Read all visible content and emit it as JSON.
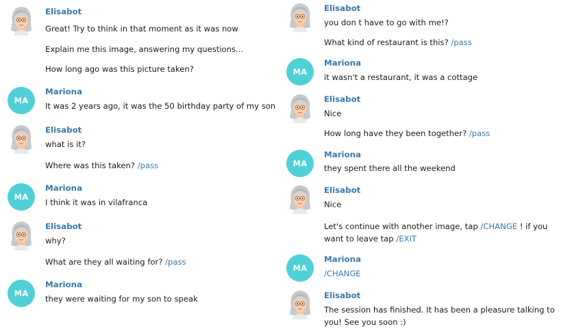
{
  "left": [
    {
      "sender": "Elisabot",
      "type": "bot",
      "lines": [
        {
          "text": "Great! Try to think in that moment as it was now",
          "cmd": ""
        },
        {
          "text": "Explain me this image, answering my questions...",
          "cmd": ""
        },
        {
          "text": "How long ago was this picture taken?",
          "cmd": ""
        }
      ]
    },
    {
      "sender": "Mariona",
      "type": "user",
      "initials": "MA",
      "lines": [
        {
          "text": "It was 2 years ago, it was the 50 birthday party of my son",
          "cmd": ""
        }
      ]
    },
    {
      "sender": "Elisabot",
      "type": "bot",
      "lines": [
        {
          "text": "what is it?",
          "cmd": ""
        },
        {
          "text": "Where was this taken?",
          "cmd": "/pass"
        }
      ]
    },
    {
      "sender": "Mariona",
      "type": "user",
      "initials": "MA",
      "lines": [
        {
          "text": "I think it was in vilafranca",
          "cmd": ""
        }
      ]
    },
    {
      "sender": "Elisabot",
      "type": "bot",
      "lines": [
        {
          "text": "why?",
          "cmd": ""
        },
        {
          "text": "What are they all waiting for?",
          "cmd": "/pass"
        }
      ]
    },
    {
      "sender": "Mariona",
      "type": "user",
      "initials": "MA",
      "lines": [
        {
          "text": "they were waiting for my son to speak",
          "cmd": ""
        }
      ]
    }
  ],
  "right": [
    {
      "sender": "Elisabot",
      "type": "bot",
      "lines": [
        {
          "text": "you don t have to go with me!?",
          "cmd": ""
        },
        {
          "text": "What kind of restaurant is this?",
          "cmd": "/pass"
        }
      ]
    },
    {
      "sender": "Mariona",
      "type": "user",
      "initials": "MA",
      "lines": [
        {
          "text": "it wasn't a restaurant, it was a cottage",
          "cmd": ""
        }
      ]
    },
    {
      "sender": "Elisabot",
      "type": "bot",
      "lines": [
        {
          "text": "Nice",
          "cmd": ""
        },
        {
          "text": "How long have they been together?",
          "cmd": "/pass"
        }
      ]
    },
    {
      "sender": "Mariona",
      "type": "user",
      "initials": "MA",
      "lines": [
        {
          "text": "they spent there all the weekend",
          "cmd": ""
        }
      ]
    },
    {
      "sender": "Elisabot",
      "type": "bot",
      "lines": [
        {
          "text": "Nice",
          "cmd": ""
        },
        {
          "parts": [
            {
              "text": "Let's continue with another image, tap ",
              "cmd": false
            },
            {
              "text": "/CHANGE",
              "cmd": true
            },
            {
              "text": " ! if you want to leave tap ",
              "cmd": false
            },
            {
              "text": "/EXIT",
              "cmd": true
            }
          ]
        }
      ]
    },
    {
      "sender": "Mariona",
      "type": "user",
      "initials": "MA",
      "lines": [
        {
          "text": "",
          "cmd": "/CHANGE"
        }
      ]
    },
    {
      "sender": "Elisabot",
      "type": "bot",
      "lines": [
        {
          "text": "The session has finished. It has been a pleasure talking to you! See you soon :)",
          "cmd": ""
        }
      ]
    }
  ],
  "colors": {
    "user_avatar": "#4fd0d7",
    "name": "#3a77ab",
    "command": "#3a77ab"
  },
  "icons": {
    "bot_avatar": "grandmother-avatar-icon"
  }
}
